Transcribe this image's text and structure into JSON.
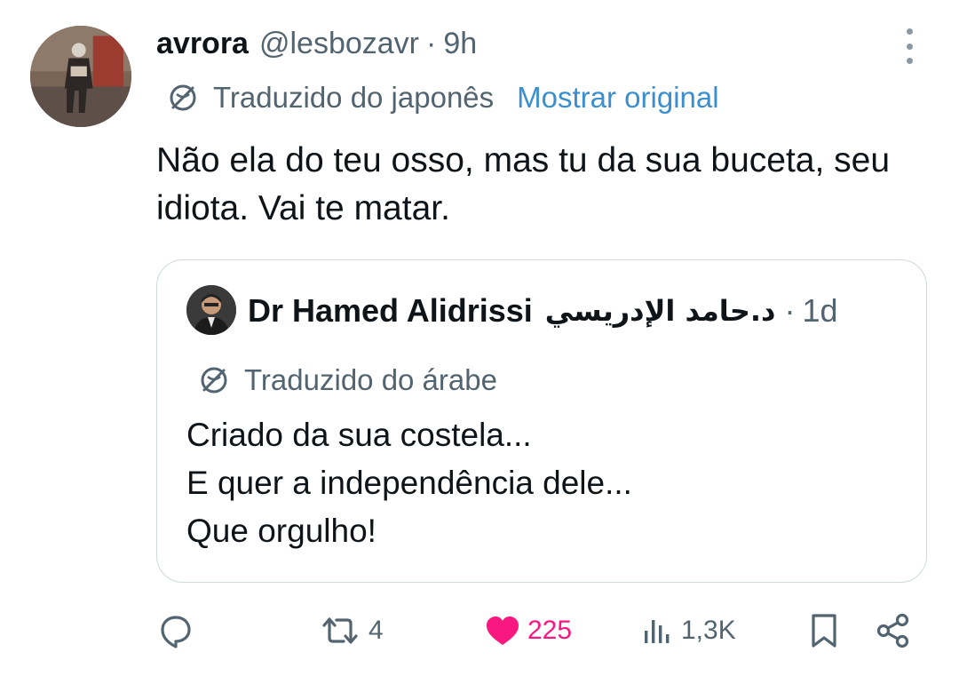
{
  "tweet": {
    "author_name": "avrora",
    "author_handle": "@lesbozavr",
    "separator": "·",
    "time": "9h",
    "translated_label": "Traduzido do japonês",
    "show_original": "Mostrar original",
    "text": "Não ela do teu osso, mas tu da sua buceta, seu idiota. Vai te matar."
  },
  "quote": {
    "author_name": "Dr Hamed Alidrissi",
    "author_name_arabic": "د.حامد الإدريسي",
    "separator": "·",
    "time": "1d",
    "translated_label": "Traduzido do árabe",
    "lines": [
      "Criado da sua costela...",
      "E quer a independência dele...",
      "Que orgulho!"
    ]
  },
  "actions": {
    "reply_count": "",
    "retweet_count": "4",
    "like_count": "225",
    "views_count": "1,3K"
  },
  "icons": {
    "more": "more-vertical-icon",
    "translate": "translate-globe-icon",
    "reply": "reply-icon",
    "retweet": "retweet-icon",
    "like": "heart-filled-icon",
    "views": "views-bars-icon",
    "bookmark": "bookmark-icon",
    "share": "share-icon"
  },
  "colors": {
    "text": "#0f1419",
    "secondary": "#536471",
    "link": "#3b8fcf",
    "like": "#f91880",
    "border": "#cfd9de"
  }
}
